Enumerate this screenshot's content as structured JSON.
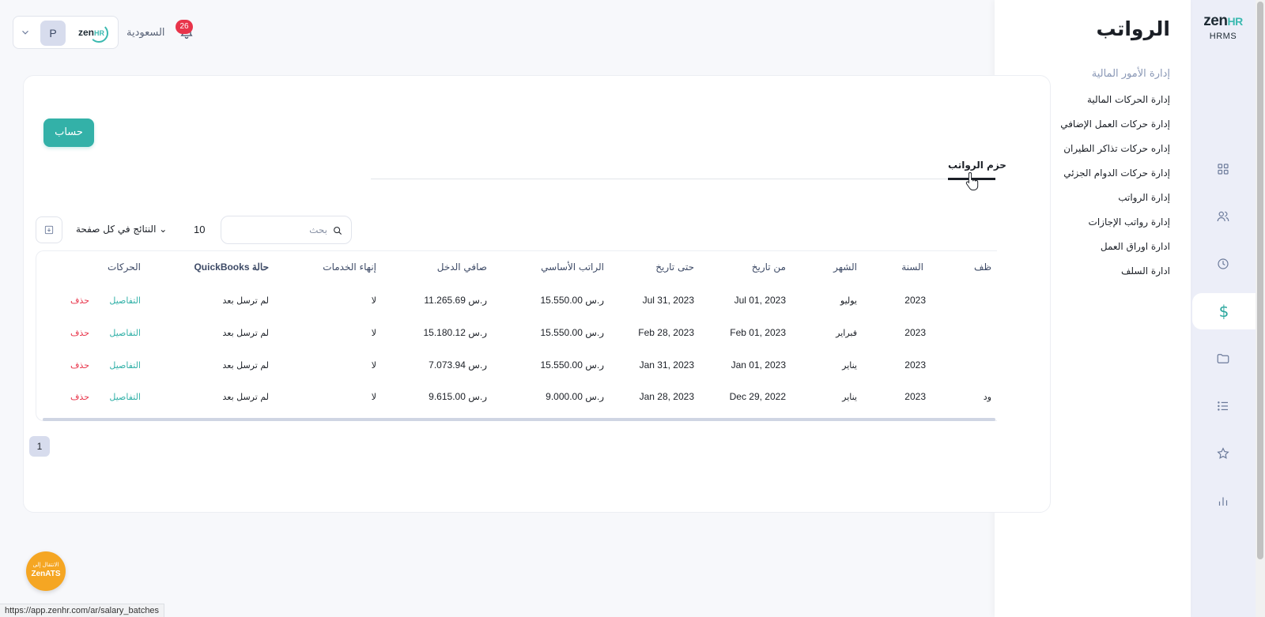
{
  "brand": {
    "name": "zen",
    "suffix": "HR",
    "product": "HRMS"
  },
  "colors": {
    "accent": "#33b1a8",
    "danger": "#e8344a",
    "rail_bg": "#eceef8",
    "badge": "#e8344a",
    "ats": "#f5a623"
  },
  "header": {
    "avatar_initial": "P",
    "country": "السعودية",
    "notifications_count": "26"
  },
  "rail": {
    "icons": [
      "dashboard-icon",
      "users-icon",
      "clock-icon",
      "dollar-icon",
      "folder-icon",
      "list-icon",
      "star-icon",
      "bar-chart-icon"
    ],
    "active_symbol": "$"
  },
  "submenu": {
    "title": "الرواتب",
    "group_label": "إدارة الأمور المالية",
    "items": [
      "إدارة الحركات المالية",
      "إدارة حركات العمل الإضافي",
      "إداره حركات تذاكر الطيران",
      "إدارة حركات الدوام الجزئي",
      "إدارة الرواتب",
      "إدارة رواتب الإجازات",
      "ادارة اوراق العمل",
      "ادارة السلف"
    ]
  },
  "main": {
    "calculate_label": "حساب",
    "active_tab": "حزم الرواتب",
    "per_page_label": "النتائج في كل صفحة",
    "per_page_value": "10",
    "search_placeholder": "بحث"
  },
  "table": {
    "columns": {
      "employee": "ظف",
      "year": "السنة",
      "month": "الشهر",
      "from": "من تاريخ",
      "to": "حتى تاريخ",
      "basic": "الراتب الأساسي",
      "net": "صافي الدخل",
      "termination": "إنهاء الخدمات",
      "quickbooks": "حالة QuickBooks",
      "actions": "الحركات"
    },
    "rows": [
      {
        "employee": "",
        "year": "2023",
        "month": "يوليو",
        "from": "Jul 01, 2023",
        "to": "Jul 31, 2023",
        "basic": "15.550.00 ر.س",
        "net": "11.265.69 ر.س",
        "termination": "لا",
        "quickbooks": "لم ترسل بعد",
        "details": "التفاصيل",
        "delete": "حذف"
      },
      {
        "employee": "",
        "year": "2023",
        "month": "فبراير",
        "from": "Feb 01, 2023",
        "to": "Feb 28, 2023",
        "basic": "15.550.00 ر.س",
        "net": "15.180.12 ر.س",
        "termination": "لا",
        "quickbooks": "لم ترسل بعد",
        "details": "التفاصيل",
        "delete": "حذف"
      },
      {
        "employee": "",
        "year": "2023",
        "month": "يناير",
        "from": "Jan 01, 2023",
        "to": "Jan 31, 2023",
        "basic": "15.550.00 ر.س",
        "net": "7.073.94 ر.س",
        "termination": "لا",
        "quickbooks": "لم ترسل بعد",
        "details": "التفاصيل",
        "delete": "حذف"
      },
      {
        "employee": "ود",
        "year": "2023",
        "month": "يناير",
        "from": "Dec 29, 2022",
        "to": "Jan 28, 2023",
        "basic": "9.000.00 ر.س",
        "net": "9.615.00 ر.س",
        "termination": "لا",
        "quickbooks": "لم ترسل بعد",
        "details": "التفاصيل",
        "delete": "حذف"
      }
    ]
  },
  "pagination": {
    "current": "1"
  },
  "zenats": {
    "line1": "الانتقال إلى",
    "line2": "ZenATS"
  },
  "statusbar": {
    "url": "https://app.zenhr.com/ar/salary_batches"
  }
}
